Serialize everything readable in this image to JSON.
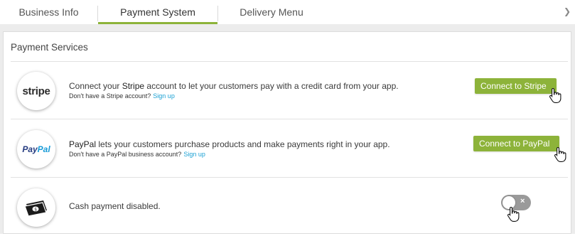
{
  "tabs": [
    {
      "label": "Business Info",
      "active": false
    },
    {
      "label": "Payment System",
      "active": true
    },
    {
      "label": "Delivery Menu",
      "active": false
    }
  ],
  "accent_color": "#8db33a",
  "link_color": "#1ba1d4",
  "section": {
    "title": "Payment Services"
  },
  "services": [
    {
      "logo": "stripe-logo",
      "logo_text": "stripe",
      "desc_pre": "Connect your ",
      "desc_bold": "Stripe",
      "desc_post": " account to let your customers pay with a credit card from your app.",
      "sub_text": "Don't have a Stripe account?",
      "sub_link": "Sign up",
      "button": "Connect to Stripe"
    },
    {
      "logo": "paypal-logo",
      "logo_text_1": "Pay",
      "logo_text_2": "Pal",
      "desc_bold": "PayPal",
      "desc_post": " lets your customers purchase products and make payments right in your app.",
      "sub_text": "Don't have a PayPal business account?",
      "sub_link": "Sign up",
      "button": "Connect to PayPal"
    },
    {
      "logo": "cash-icon",
      "desc": "Cash payment disabled.",
      "toggle_on": false,
      "toggle_symbol": "×"
    }
  ]
}
